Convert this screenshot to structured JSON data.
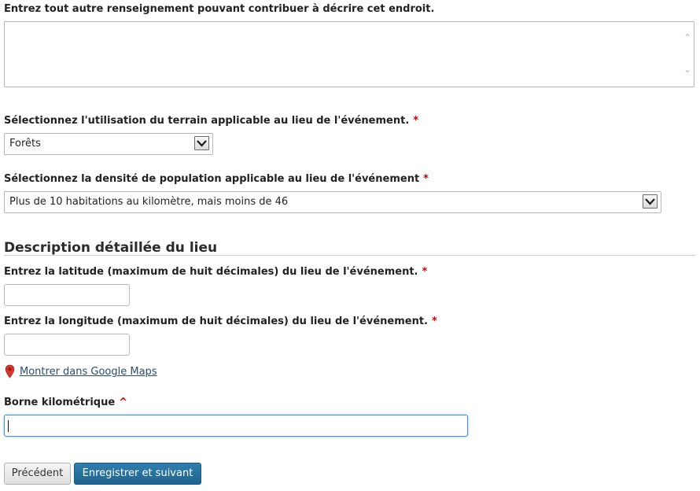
{
  "textarea_prompt": "Entrez tout autre renseignement pouvant contribuer à décrire cet endroit.",
  "land_use": {
    "label": "Sélectionnez l'utilisation du terrain applicable au lieu de l'événement.",
    "required_mark": "*",
    "value": "Forêts"
  },
  "population_density": {
    "label": "Sélectionnez la densité de population applicable au lieu de l'événement",
    "required_mark": "*",
    "value": "Plus de 10 habitations au kilomètre, mais moins de 46"
  },
  "section": {
    "title": "Description détaillée du lieu"
  },
  "latitude": {
    "label": "Entrez la latitude (maximum de huit décimales) du lieu de l'événement.",
    "required_mark": "*",
    "value": ""
  },
  "longitude": {
    "label": "Entrez la longitude (maximum de huit décimales) du lieu de l'événement.",
    "required_mark": "*",
    "value": ""
  },
  "maps": {
    "link": "Montrer dans Google Maps",
    "icon": "map-pin-icon",
    "pin_color": "#d9342b"
  },
  "km_marker": {
    "label": "Borne kilométrique",
    "required_mark": "^",
    "value": ""
  },
  "buttons": {
    "previous": "Précédent",
    "save_next": "Enregistrer et suivant"
  },
  "colors": {
    "required": "#d00000",
    "primary_button": "#23689a",
    "link": "#2a4d6e",
    "focus_border": "#4a90d9"
  }
}
